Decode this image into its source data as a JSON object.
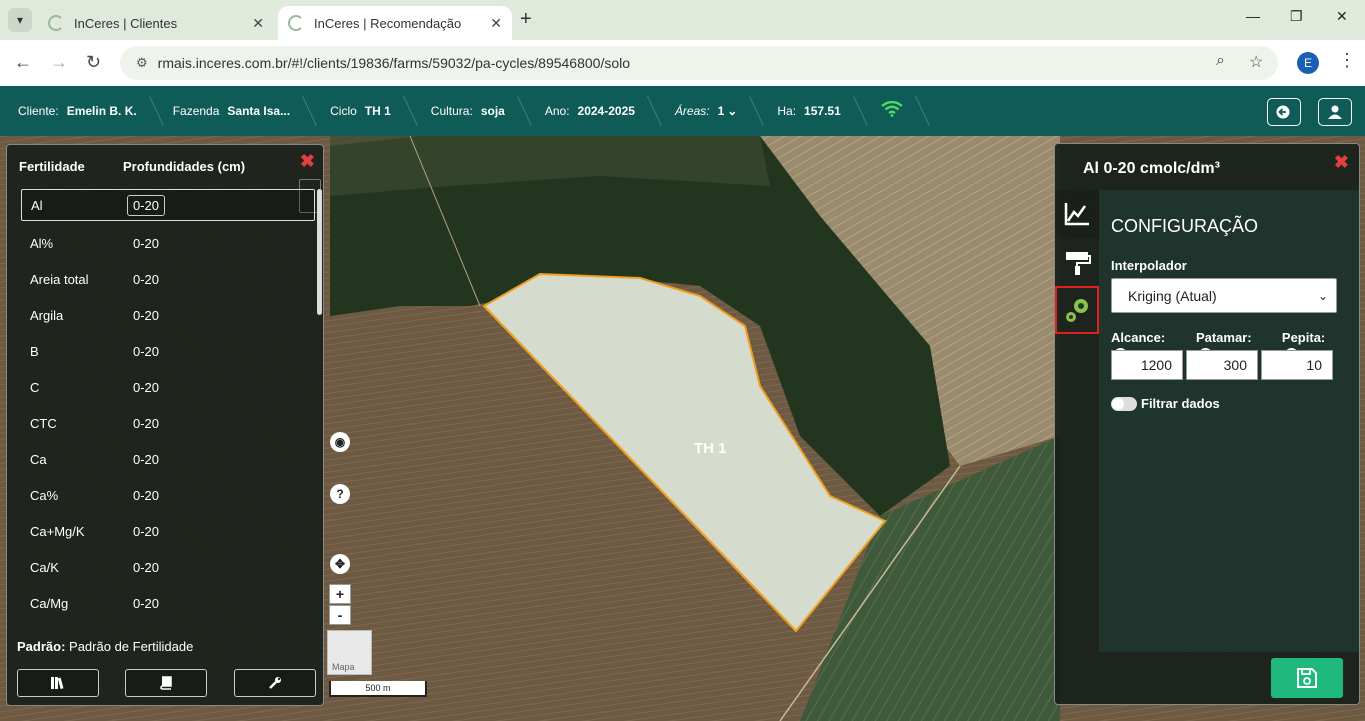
{
  "browser": {
    "tabs": [
      {
        "title": "InCeres | Clientes",
        "close": "✕"
      },
      {
        "title": "InCeres | Recomendação",
        "close": "✕"
      }
    ],
    "new_tab": "+",
    "url": "rmais.inceres.com.br/#!/clients/19836/farms/59032/pa-cycles/89546800/solo",
    "profile_initial": "E"
  },
  "header": {
    "cliente_label": "Cliente:",
    "cliente": "Emelin B. K.",
    "fazenda_label": "Fazenda",
    "fazenda": "Santa Isa...",
    "ciclo_label": "Ciclo",
    "ciclo": "TH 1",
    "cultura_label": "Cultura:",
    "cultura": "soja",
    "ano_label": "Ano:",
    "ano": "2024-2025",
    "areas_label": "Áreas:",
    "areas": "1",
    "ha_label": "Ha:",
    "ha": "157.51"
  },
  "left_panel": {
    "col1": "Fertilidade",
    "col2": "Profundidades (cm)",
    "rows": [
      {
        "name": "Al",
        "depth": "0-20",
        "selected": true
      },
      {
        "name": "Al%",
        "depth": "0-20"
      },
      {
        "name": "Areia total",
        "depth": "0-20"
      },
      {
        "name": "Argila",
        "depth": "0-20"
      },
      {
        "name": "B",
        "depth": "0-20"
      },
      {
        "name": "C",
        "depth": "0-20"
      },
      {
        "name": "CTC",
        "depth": "0-20"
      },
      {
        "name": "Ca",
        "depth": "0-20"
      },
      {
        "name": "Ca%",
        "depth": "0-20"
      },
      {
        "name": "Ca+Mg/K",
        "depth": "0-20"
      },
      {
        "name": "Ca/K",
        "depth": "0-20"
      },
      {
        "name": "Ca/Mg",
        "depth": "0-20"
      }
    ],
    "padrao_label": "Padrão:",
    "padrao_value": "Padrão de Fertilidade"
  },
  "map": {
    "field_label": "TH 1",
    "maptype_label": "Mapa",
    "scale_label": "500 m",
    "zoom_in": "+",
    "zoom_out": "-"
  },
  "right_panel": {
    "title": "Al 0-20 cmolc/dm³",
    "section": "CONFIGURAÇÃO",
    "interpolador_label": "Interpolador",
    "interpolador_value": "Kriging (Atual)",
    "alcance_label": "Alcance:",
    "patamar_label": "Patamar:",
    "pepita_label": "Pepita:",
    "alcance": "1200",
    "patamar": "300",
    "pepita": "10",
    "filter_label": "Filtrar dados"
  },
  "colors": {
    "header_bg": "#0f5b57",
    "save_button": "#1fb97e",
    "field_fill": "#d6dccd",
    "field_outline": "#f0a020",
    "close_red": "#e04040"
  }
}
